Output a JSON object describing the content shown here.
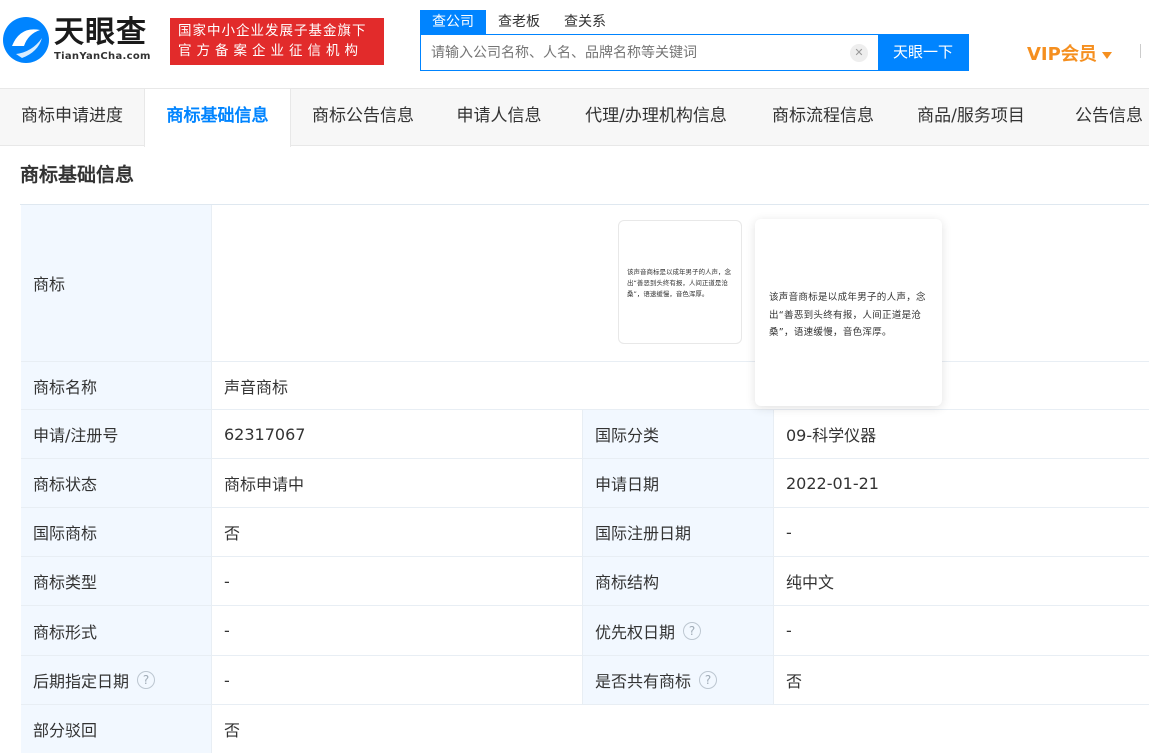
{
  "header": {
    "logo_cn": "天眼查",
    "logo_en": "TianYanCha.com",
    "slogan_line1": "国家中小企业发展子基金旗下",
    "slogan_line2": "官方备案企业征信机构",
    "search_tabs": [
      "查公司",
      "查老板",
      "查关系"
    ],
    "search_placeholder": "请输入公司名称、人名、品牌名称等关键词",
    "search_button": "天眼一下",
    "vip_label": "VIP会员"
  },
  "nav": {
    "items": [
      "商标申请进度",
      "商标基础信息",
      "商标公告信息",
      "申请人信息",
      "代理/办理机构信息",
      "商标流程信息",
      "商品/服务项目",
      "公告信息"
    ],
    "active_index": 1
  },
  "section_title": "商标基础信息",
  "trademark_text": "该声音商标是以成年男子的人声，念出“善恶到头终有报，人间正道是沧桑”，语速缓慢，音色浑厚。",
  "table": {
    "trademark_label": "商标",
    "name_label": "商标名称",
    "name_value": "声音商标",
    "rows": [
      {
        "l1": "申请/注册号",
        "v1": "62317067",
        "l2": "国际分类",
        "v2": "09-科学仪器"
      },
      {
        "l1": "商标状态",
        "v1": "商标申请中",
        "l2": "申请日期",
        "v2": "2022-01-21"
      },
      {
        "l1": "国际商标",
        "v1": "否",
        "l2": "国际注册日期",
        "v2": "-"
      },
      {
        "l1": "商标类型",
        "v1": "-",
        "l2": "商标结构",
        "v2": "纯中文"
      },
      {
        "l1": "商标形式",
        "v1": "-",
        "l2": "优先权日期",
        "v2": "-"
      },
      {
        "l1": "后期指定日期",
        "v1": "-",
        "l2": "是否共有商标",
        "v2": "否"
      }
    ],
    "partial_label": "部分驳回",
    "partial_value": "否",
    "help_glyph": "?"
  }
}
